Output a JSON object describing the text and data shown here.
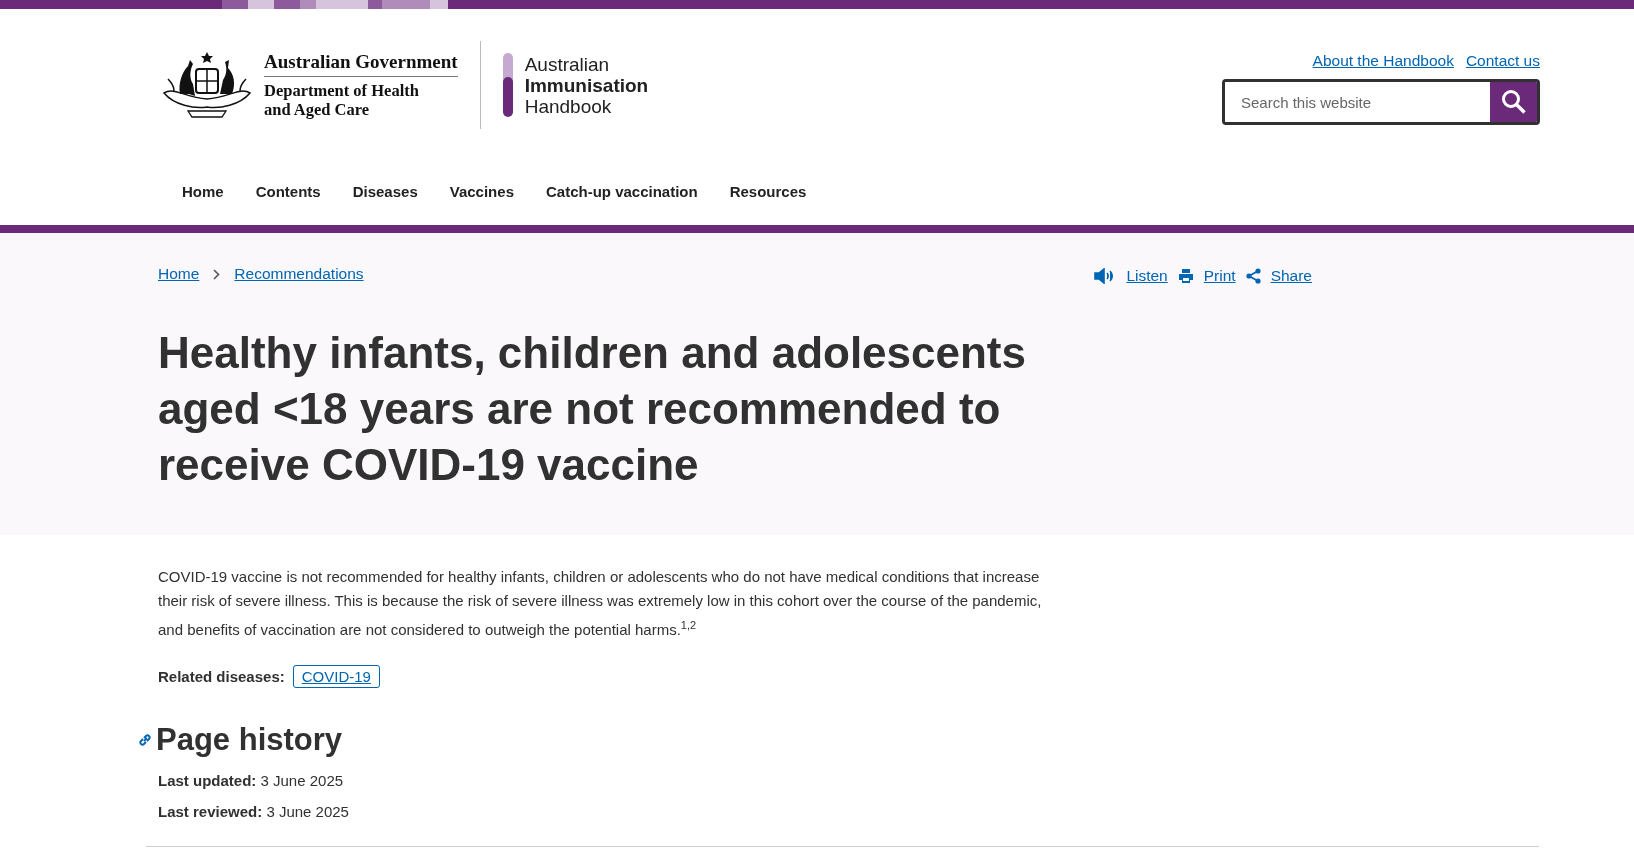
{
  "header": {
    "government": {
      "name": "Australian Government",
      "department": [
        "Department of Health",
        "and Aged Care"
      ]
    },
    "handbook": [
      "Australian",
      "Immunisation",
      "Handbook"
    ],
    "utility_links": [
      "About the Handbook",
      "Contact us"
    ],
    "search": {
      "placeholder": "Search this website"
    }
  },
  "nav": [
    "Home",
    "Contents",
    "Diseases",
    "Vaccines",
    "Catch-up vaccination",
    "Resources"
  ],
  "breadcrumb": [
    "Home",
    "Recommendations"
  ],
  "actions": [
    {
      "kind": "listen",
      "label": "Listen"
    },
    {
      "kind": "print",
      "label": "Print"
    },
    {
      "kind": "share",
      "label": "Share"
    }
  ],
  "title": "Healthy infants, children and adolescents aged <18 years are not recommended to receive COVID-19 vaccine",
  "body": "COVID-19 vaccine is not recommended for healthy infants, children or adolescents who do not have medical conditions that increase their risk of severe illness. This is because the risk of severe illness was extremely low in this cohort over the course of the pandemic, and benefits of vaccination are not considered to outweigh the potential harms.$^{1,2}$",
  "related": {
    "label": "Related diseases:",
    "tags": [
      "COVID-19"
    ]
  },
  "history": {
    "heading": "Page history",
    "items": [
      {
        "label": "Last updated:",
        "value": "3 June 2025"
      },
      {
        "label": "Last reviewed:",
        "value": "3 June 2025"
      }
    ]
  }
}
